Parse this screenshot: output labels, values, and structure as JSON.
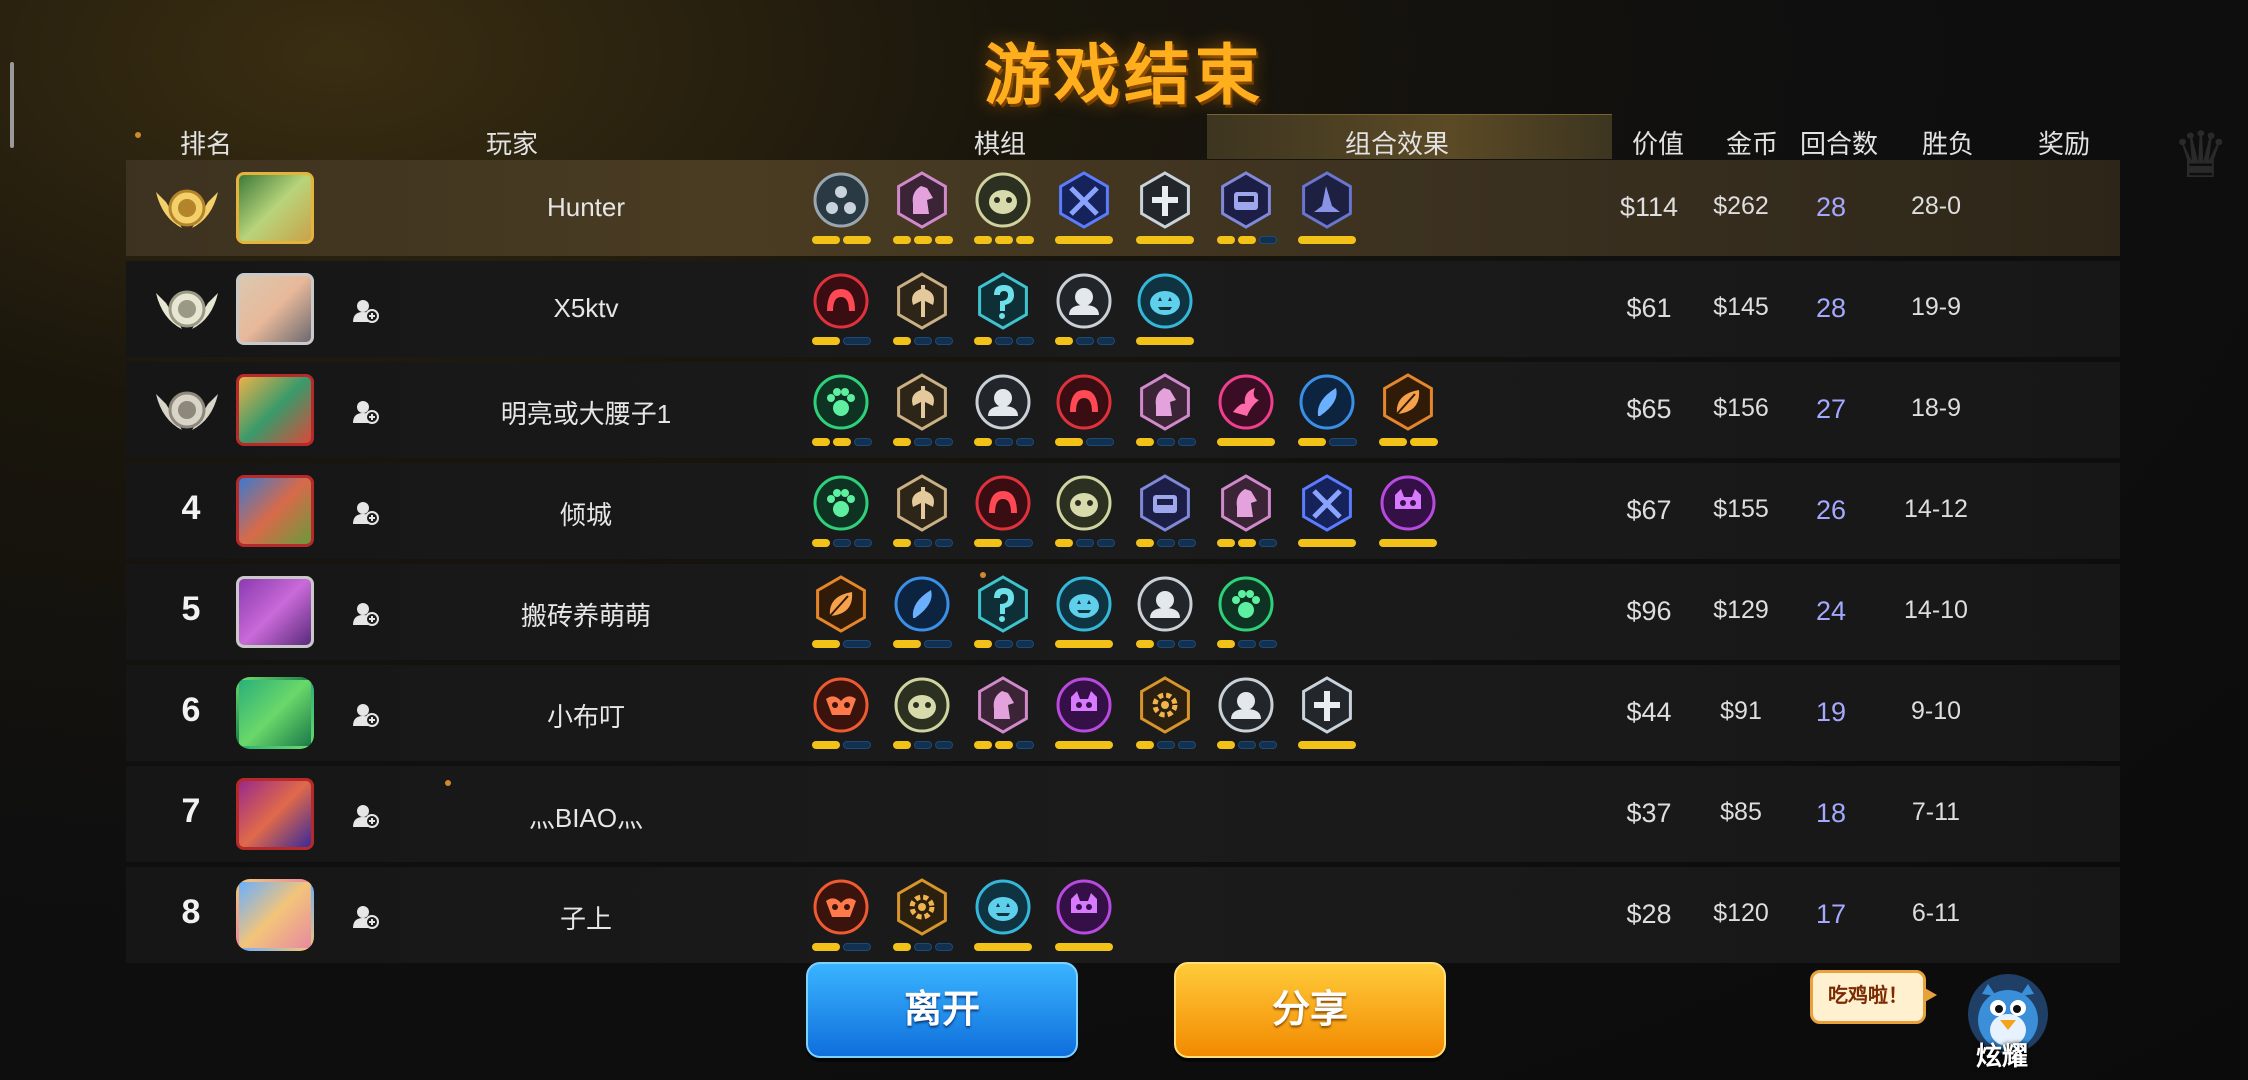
{
  "title": "游戏结束",
  "headers": {
    "rank": "排名",
    "player": "玩家",
    "pieces": "棋组",
    "combo": "组合效果",
    "value": "价值",
    "gold": "金币",
    "rounds": "回合数",
    "record": "胜负",
    "reward": "奖励"
  },
  "rows": [
    {
      "rank": "1",
      "medal": "gold",
      "name": "Hunter",
      "value": "$114",
      "gold": "$262",
      "rounds": "28",
      "record": "28-0",
      "traits": [
        {
          "icon": "triple-orb-icon",
          "color": "#2a3a44",
          "ring": "#9aa7b0",
          "shape": "circle",
          "pips": [
            1,
            1
          ]
        },
        {
          "icon": "knight-icon",
          "color": "#3a2436",
          "ring": "#d08acb",
          "shape": "hex",
          "pips": [
            1,
            1,
            1
          ]
        },
        {
          "icon": "beast-icon",
          "color": "#2c3020",
          "ring": "#cfd3a0",
          "shape": "circle",
          "pips": [
            1,
            1,
            1
          ]
        },
        {
          "icon": "crossed-swords-icon",
          "color": "#16225a",
          "ring": "#5b7cff",
          "shape": "hex",
          "pips": [
            1
          ]
        },
        {
          "icon": "cross-icon",
          "color": "#23272c",
          "ring": "#c9d3dc",
          "shape": "hex",
          "pips": [
            1
          ]
        },
        {
          "icon": "mech-icon",
          "color": "#1d1e45",
          "ring": "#8088d8",
          "shape": "hex",
          "pips": [
            1,
            1,
            0
          ]
        },
        {
          "icon": "wizard-hat-icon",
          "color": "#1d2040",
          "ring": "#6a75d0",
          "shape": "hex",
          "pips": [
            1
          ]
        }
      ]
    },
    {
      "rank": "2",
      "medal": "silver",
      "name": "X5ktv",
      "value": "$61",
      "gold": "$145",
      "rounds": "28",
      "record": "19-9",
      "traits": [
        {
          "icon": "demon-horns-icon",
          "color": "#3a0d12",
          "ring": "#e0323d",
          "shape": "circle",
          "pips": [
            1,
            0
          ]
        },
        {
          "icon": "axe-icon",
          "color": "#2d2618",
          "ring": "#cbb084",
          "shape": "hex",
          "pips": [
            1,
            0,
            0
          ]
        },
        {
          "icon": "mystic-icon",
          "color": "#0d2f35",
          "ring": "#3ec3cf",
          "shape": "hex",
          "pips": [
            1,
            0,
            0
          ]
        },
        {
          "icon": "helm-icon",
          "color": "#22262b",
          "ring": "#c9d0d6",
          "shape": "circle",
          "pips": [
            1,
            0,
            0
          ]
        },
        {
          "icon": "pumpkin-icon",
          "color": "#0f3340",
          "ring": "#34b7d8",
          "shape": "circle",
          "pips": [
            1
          ]
        }
      ]
    },
    {
      "rank": "3",
      "medal": "bronze",
      "name": "明亮或大腰子1",
      "value": "$65",
      "gold": "$156",
      "rounds": "27",
      "record": "18-9",
      "traits": [
        {
          "icon": "paw-icon",
          "color": "#0e3322",
          "ring": "#2fd07a",
          "shape": "circle",
          "pips": [
            1,
            1,
            0
          ]
        },
        {
          "icon": "axe-icon",
          "color": "#2d2618",
          "ring": "#cbb084",
          "shape": "hex",
          "pips": [
            1,
            0,
            0
          ]
        },
        {
          "icon": "helm-icon",
          "color": "#22262b",
          "ring": "#c9d0d6",
          "shape": "circle",
          "pips": [
            1,
            0,
            0
          ]
        },
        {
          "icon": "demon-horns-icon",
          "color": "#3a0d12",
          "ring": "#e0323d",
          "shape": "circle",
          "pips": [
            1,
            0
          ]
        },
        {
          "icon": "knight-icon",
          "color": "#3a2436",
          "ring": "#d08acb",
          "shape": "hex",
          "pips": [
            1,
            0,
            0
          ]
        },
        {
          "icon": "dragon-icon",
          "color": "#3a0d24",
          "ring": "#ef3f8e",
          "shape": "circle",
          "pips": [
            1
          ]
        },
        {
          "icon": "feather-icon",
          "color": "#0d2440",
          "ring": "#3a8fe6",
          "shape": "circle",
          "pips": [
            1,
            0
          ]
        },
        {
          "icon": "leaf-icon",
          "color": "#2f1b08",
          "ring": "#e6862a",
          "shape": "hex",
          "pips": [
            1,
            1
          ]
        }
      ]
    },
    {
      "rank": "4",
      "medal": "",
      "name": "倾城",
      "value": "$67",
      "gold": "$155",
      "rounds": "26",
      "record": "14-12",
      "traits": [
        {
          "icon": "paw-icon",
          "color": "#0e3322",
          "ring": "#2fd07a",
          "shape": "circle",
          "pips": [
            1,
            0,
            0
          ]
        },
        {
          "icon": "axe-icon",
          "color": "#2d2618",
          "ring": "#cbb084",
          "shape": "hex",
          "pips": [
            1,
            0,
            0
          ]
        },
        {
          "icon": "demon-horns-icon",
          "color": "#3a0d12",
          "ring": "#e0323d",
          "shape": "circle",
          "pips": [
            1,
            0
          ]
        },
        {
          "icon": "beast-icon",
          "color": "#2c3020",
          "ring": "#cfd3a0",
          "shape": "circle",
          "pips": [
            1,
            0,
            0
          ]
        },
        {
          "icon": "mech-icon",
          "color": "#1d1e45",
          "ring": "#8088d8",
          "shape": "hex",
          "pips": [
            1,
            0,
            0
          ]
        },
        {
          "icon": "knight-icon",
          "color": "#3a2436",
          "ring": "#d08acb",
          "shape": "hex",
          "pips": [
            1,
            1,
            0
          ]
        },
        {
          "icon": "crossed-swords-icon",
          "color": "#16225a",
          "ring": "#5b7cff",
          "shape": "hex",
          "pips": [
            1
          ]
        },
        {
          "icon": "skull-icon",
          "color": "#351046",
          "ring": "#b84ae0",
          "shape": "circle",
          "pips": [
            1
          ]
        }
      ]
    },
    {
      "rank": "5",
      "medal": "",
      "name": "搬砖养萌萌",
      "value": "$96",
      "gold": "$129",
      "rounds": "24",
      "record": "14-10",
      "traits": [
        {
          "icon": "leaf-icon",
          "color": "#2f1b08",
          "ring": "#e6862a",
          "shape": "hex",
          "pips": [
            1,
            0
          ]
        },
        {
          "icon": "feather-icon",
          "color": "#0d2440",
          "ring": "#3a8fe6",
          "shape": "circle",
          "pips": [
            1,
            0
          ]
        },
        {
          "icon": "mystic-icon",
          "color": "#0d2f35",
          "ring": "#3ec3cf",
          "shape": "hex",
          "pips": [
            1,
            0,
            0
          ]
        },
        {
          "icon": "pumpkin-icon",
          "color": "#0f3340",
          "ring": "#34b7d8",
          "shape": "circle",
          "pips": [
            1
          ]
        },
        {
          "icon": "helm-icon",
          "color": "#22262b",
          "ring": "#c9d0d6",
          "shape": "circle",
          "pips": [
            1,
            0,
            0
          ]
        },
        {
          "icon": "paw-icon",
          "color": "#0e3322",
          "ring": "#2fd07a",
          "shape": "circle",
          "pips": [
            1,
            0,
            0
          ]
        }
      ]
    },
    {
      "rank": "6",
      "medal": "",
      "name": "小布叮",
      "value": "$44",
      "gold": "$91",
      "rounds": "19",
      "record": "9-10",
      "traits": [
        {
          "icon": "demon-mask-icon",
          "color": "#3a140c",
          "ring": "#f05a30",
          "shape": "circle",
          "pips": [
            1,
            0
          ]
        },
        {
          "icon": "beast-icon",
          "color": "#2c3020",
          "ring": "#cfd3a0",
          "shape": "circle",
          "pips": [
            1,
            0,
            0
          ]
        },
        {
          "icon": "knight-icon",
          "color": "#3a2436",
          "ring": "#d08acb",
          "shape": "hex",
          "pips": [
            1,
            1,
            0
          ]
        },
        {
          "icon": "skull-icon",
          "color": "#351046",
          "ring": "#b84ae0",
          "shape": "circle",
          "pips": [
            1
          ]
        },
        {
          "icon": "gear-icon",
          "color": "#2b2010",
          "ring": "#d8962a",
          "shape": "hex",
          "pips": [
            1,
            0,
            0
          ]
        },
        {
          "icon": "helm-icon",
          "color": "#22262b",
          "ring": "#c9d0d6",
          "shape": "circle",
          "pips": [
            1,
            0,
            0
          ]
        },
        {
          "icon": "cross-icon",
          "color": "#23272c",
          "ring": "#c9d3dc",
          "shape": "hex",
          "pips": [
            1
          ]
        }
      ]
    },
    {
      "rank": "7",
      "medal": "",
      "name": "灬BIAO灬",
      "value": "$37",
      "gold": "$85",
      "rounds": "18",
      "record": "7-11",
      "traits": []
    },
    {
      "rank": "8",
      "medal": "",
      "name": "子上",
      "value": "$28",
      "gold": "$120",
      "rounds": "17",
      "record": "6-11",
      "traits": [
        {
          "icon": "demon-mask-icon",
          "color": "#3a140c",
          "ring": "#f05a30",
          "shape": "circle",
          "pips": [
            1,
            0
          ]
        },
        {
          "icon": "gear-icon",
          "color": "#2b2010",
          "ring": "#d8962a",
          "shape": "hex",
          "pips": [
            1,
            0,
            0
          ]
        },
        {
          "icon": "pumpkin-icon",
          "color": "#0f3340",
          "ring": "#34b7d8",
          "shape": "circle",
          "pips": [
            1
          ]
        },
        {
          "icon": "skull-icon",
          "color": "#351046",
          "ring": "#b84ae0",
          "shape": "circle",
          "pips": [
            1
          ]
        }
      ]
    }
  ],
  "buttons": {
    "leave": "离开",
    "share": "分享"
  },
  "bubble": "吃鸡啦！",
  "brag": "炫耀",
  "colors": {
    "title": "#ffae1e",
    "pip_on": "#f2c218",
    "rounds": "#a4a8ff"
  }
}
